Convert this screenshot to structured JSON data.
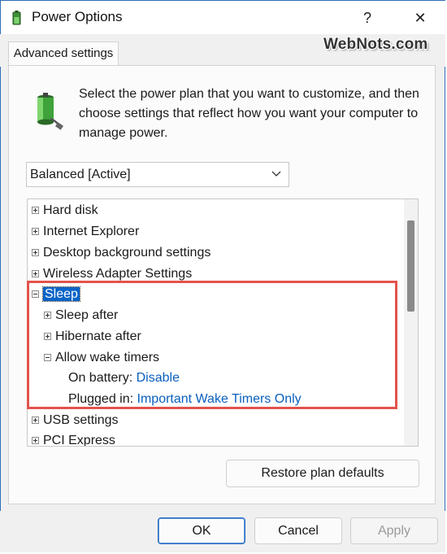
{
  "window": {
    "title": "Power Options",
    "help_glyph": "?",
    "close_glyph": "✕",
    "icon": "power-options-icon"
  },
  "tabs": [
    {
      "label": "Advanced settings",
      "active": true
    }
  ],
  "watermark": "WebNots.com",
  "intro_text": "Select the power plan that you want to customize, and then choose settings that reflect how you want your computer to manage power.",
  "plan_dropdown": {
    "selected": "Balanced [Active]"
  },
  "tree": {
    "items": [
      {
        "label": "Hard disk",
        "level": 0,
        "expander": "plus"
      },
      {
        "label": "Internet Explorer",
        "level": 0,
        "expander": "plus"
      },
      {
        "label": "Desktop background settings",
        "level": 0,
        "expander": "plus"
      },
      {
        "label": "Wireless Adapter Settings",
        "level": 0,
        "expander": "plus"
      },
      {
        "label": "Sleep",
        "level": 0,
        "expander": "minus",
        "selected": true
      },
      {
        "label": "Sleep after",
        "level": 1,
        "expander": "plus"
      },
      {
        "label": "Hibernate after",
        "level": 1,
        "expander": "plus"
      },
      {
        "label": "Allow wake timers",
        "level": 1,
        "expander": "minus"
      },
      {
        "label": "On battery:",
        "level": 2,
        "value": "Disable"
      },
      {
        "label": "Plugged in:",
        "level": 2,
        "value": "Important Wake Timers Only"
      },
      {
        "label": "USB settings",
        "level": 0,
        "expander": "plus"
      },
      {
        "label": "PCI Express",
        "level": 0,
        "expander": "plus"
      }
    ]
  },
  "buttons": {
    "restore": "Restore plan defaults",
    "ok": "OK",
    "cancel": "Cancel",
    "apply": "Apply"
  },
  "colors": {
    "selection": "#0a64c8",
    "link": "#0a5fbd",
    "highlight_box": "#e2534b"
  }
}
